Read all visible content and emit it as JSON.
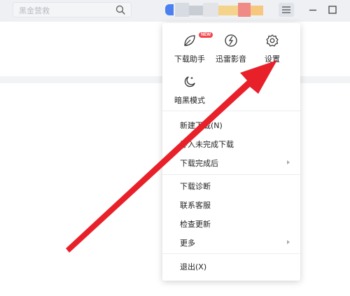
{
  "search": {
    "placeholder": "黑金营救"
  },
  "header": {
    "avatar_colors": [
      "#4b80f0",
      "#d7dbe2",
      "#c8ccd3",
      "#e2e4e8",
      "#f4d38a",
      "#f0b08f",
      "#ef8a86",
      "#f6c77e"
    ]
  },
  "menu": {
    "tools": [
      {
        "label": "下载助手",
        "icon": "leaf-icon",
        "badge": "NEW"
      },
      {
        "label": "迅雷影音",
        "icon": "video-icon"
      },
      {
        "label": "设置",
        "icon": "gear-icon"
      },
      {
        "label": "暗黑模式",
        "icon": "moon-icon"
      }
    ],
    "items": [
      {
        "label": "新建下载(N)"
      },
      {
        "label": "导入未完成下载"
      },
      {
        "label": "下载完成后",
        "submenu": true
      },
      {
        "label": "下载诊断"
      },
      {
        "label": "联系客服"
      },
      {
        "label": "检查更新"
      },
      {
        "label": "更多",
        "submenu": true
      },
      {
        "label": "退出(X)"
      }
    ]
  },
  "colors": {
    "arrow": "#e8202a",
    "accent": "#4b80f0"
  }
}
